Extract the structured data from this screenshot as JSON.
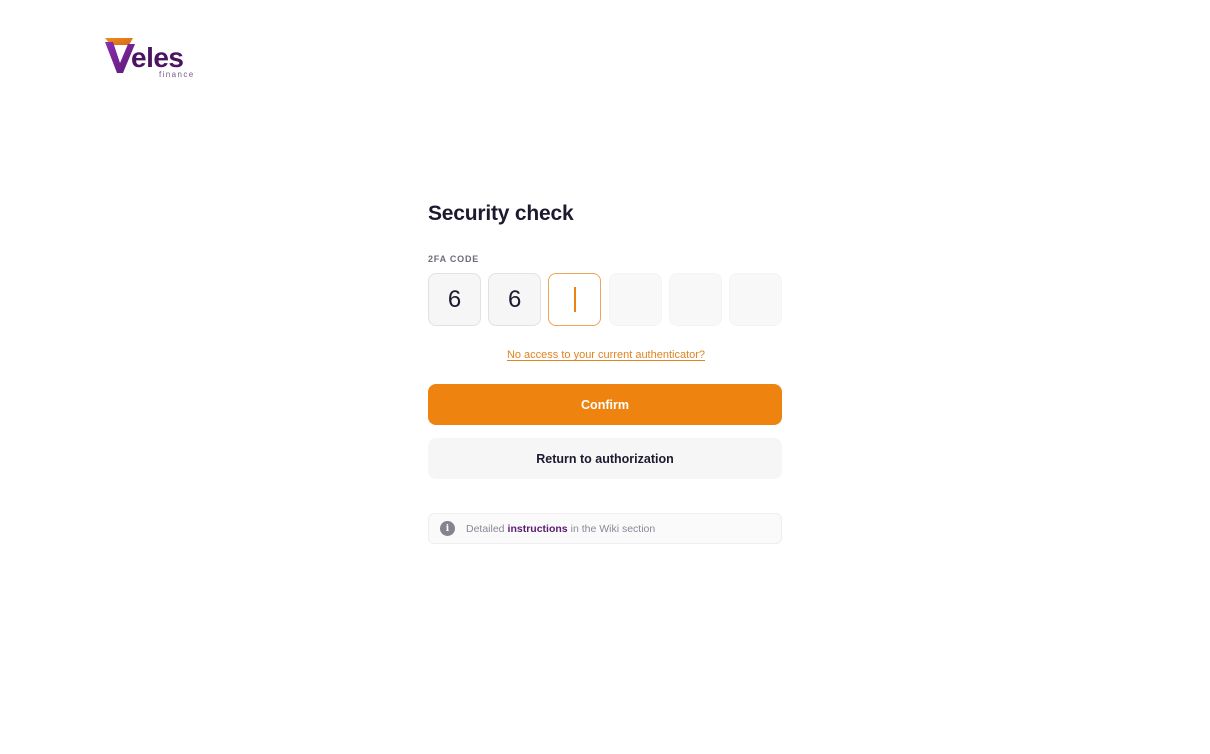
{
  "logo": {
    "wordmark": "eles",
    "sub": "finance"
  },
  "form": {
    "title": "Security check",
    "code_label": "2FA CODE",
    "code_digits": [
      "6",
      "6",
      "",
      "",
      "",
      ""
    ],
    "no_access_link": "No access to your current authenticator?",
    "confirm_label": "Confirm",
    "return_label": "Return to authorization"
  },
  "info": {
    "icon": "info-icon",
    "prefix": "Detailed",
    "link": "instructions",
    "suffix": "in the Wiki section"
  },
  "colors": {
    "accent": "#ee830f",
    "brand": "#4a1462",
    "link_purple": "#5b1a72"
  }
}
